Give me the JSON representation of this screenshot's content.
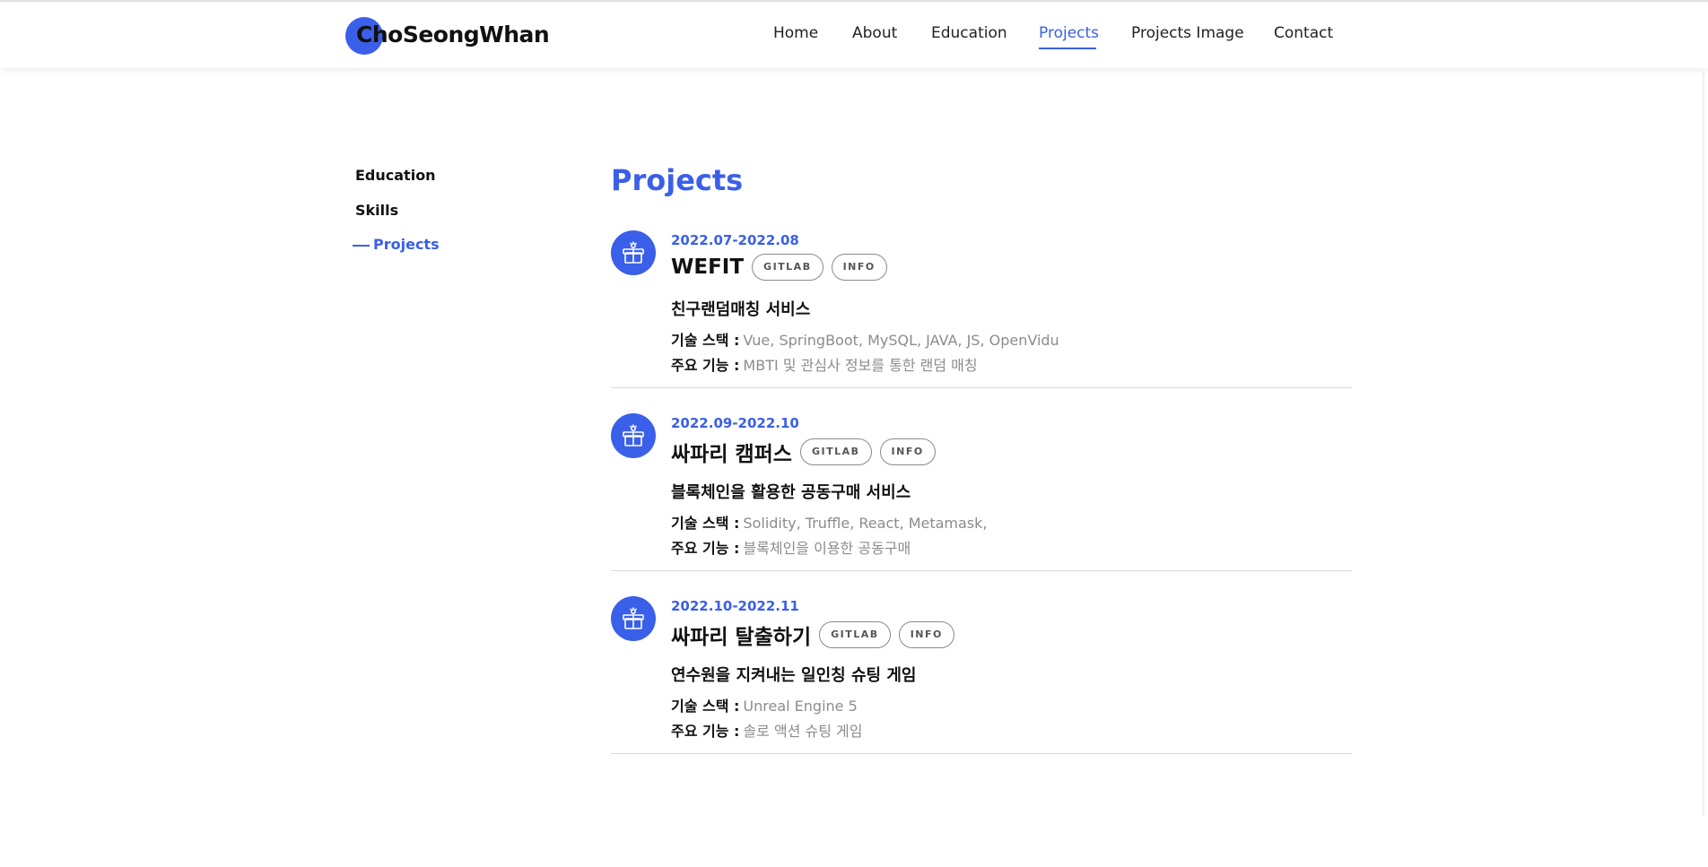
{
  "header": {
    "logo_text": "ChoSeongWhan",
    "nav": [
      {
        "label": "Home"
      },
      {
        "label": "About"
      },
      {
        "label": "Education"
      },
      {
        "label": "Projects"
      },
      {
        "label": "Projects Image"
      },
      {
        "label": "Contact"
      }
    ],
    "active_nav": "Projects"
  },
  "sidebar": {
    "items": [
      {
        "label": "Education"
      },
      {
        "label": "Skills"
      },
      {
        "label": "Projects"
      }
    ],
    "active_item": "Projects"
  },
  "main": {
    "title": "Projects",
    "projects": [
      {
        "date": "2022.07-2022.08",
        "name": "WEFIT",
        "gitlab": "GITLAB",
        "info": "INFO",
        "description": "친구랜덤매칭 서비스",
        "stack_label": "기술 스택 :",
        "stack": "Vue, SpringBoot, MySQL, JAVA, JS, OpenVidu",
        "feature_label": "주요 기능 :",
        "feature": "MBTI 및 관심사 정보를 통한 랜덤 매칭"
      },
      {
        "date": "2022.09-2022.10",
        "name": "싸파리 캠퍼스",
        "gitlab": "GITLAB",
        "info": "INFO",
        "description": "블록체인을 활용한 공동구매 서비스",
        "stack_label": "기술 스택 :",
        "stack": "Solidity, Truffle, React, Metamask,",
        "feature_label": "주요 기능 :",
        "feature": "블록체인을 이용한 공동구매"
      },
      {
        "date": "2022.10-2022.11",
        "name": "싸파리 탈출하기",
        "gitlab": "GITLAB",
        "info": "INFO",
        "description": "연수원을 지켜내는 일인칭 슈팅 게임",
        "stack_label": "기술 스택 :",
        "stack": "Unreal Engine 5",
        "feature_label": "주요 기능 :",
        "feature": "솔로 액션 슈팅 게임"
      }
    ]
  },
  "colors": {
    "accent": "#3a5fe8",
    "muted_text": "#8c8c8c",
    "divider": "#dadada"
  },
  "icons": {
    "project": "gift-icon"
  }
}
